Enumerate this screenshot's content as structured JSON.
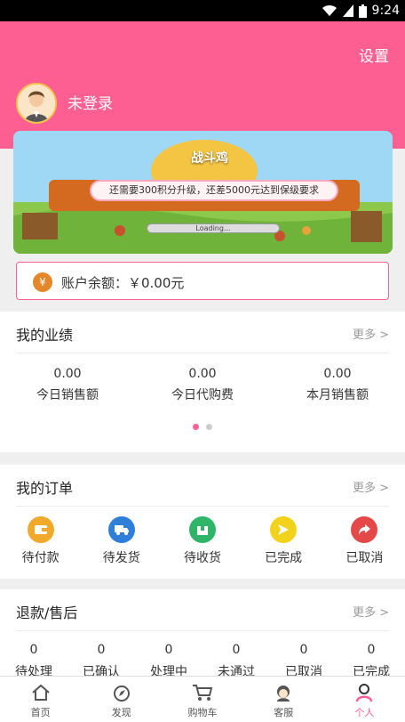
{
  "status_bar": {
    "time": "9:24"
  },
  "header": {
    "settings_label": "设置",
    "login_label": "未登录"
  },
  "banner": {
    "title": "战斗鸡",
    "message": "还需要300积分升级，还差5000元达到保级要求",
    "loading_text": "Loading..."
  },
  "balance": {
    "label": "账户余额：￥0.00元",
    "icon_char": "¥"
  },
  "performance": {
    "title": "我的业绩",
    "more": "更多 >",
    "items": [
      {
        "value": "0.00",
        "label": "今日销售额"
      },
      {
        "value": "0.00",
        "label": "今日代购费"
      },
      {
        "value": "0.00",
        "label": "本月销售额"
      }
    ]
  },
  "orders": {
    "title": "我的订单",
    "more": "更多 >",
    "items": [
      {
        "label": "待付款",
        "icon": "wallet-icon",
        "color": "#f0a92b"
      },
      {
        "label": "待发货",
        "icon": "truck-icon",
        "color": "#2f7fd8"
      },
      {
        "label": "待收货",
        "icon": "package-icon",
        "color": "#2fb567"
      },
      {
        "label": "已完成",
        "icon": "send-icon",
        "color": "#f3d21b"
      },
      {
        "label": "已取消",
        "icon": "share-icon",
        "color": "#e44848"
      }
    ]
  },
  "refunds": {
    "title": "退款/售后",
    "more": "更多 >",
    "items": [
      {
        "value": "0",
        "label": "待处理"
      },
      {
        "value": "0",
        "label": "已确认"
      },
      {
        "value": "0",
        "label": "处理中"
      },
      {
        "value": "0",
        "label": "未通过"
      },
      {
        "value": "0",
        "label": "已取消"
      },
      {
        "value": "0",
        "label": "已完成"
      }
    ]
  },
  "tabbar": {
    "items": [
      {
        "label": "首页",
        "icon": "home-icon"
      },
      {
        "label": "发现",
        "icon": "discover-icon"
      },
      {
        "label": "购物车",
        "icon": "cart-icon"
      },
      {
        "label": "客服",
        "icon": "service-icon"
      },
      {
        "label": "个人",
        "icon": "profile-icon"
      }
    ],
    "active_color": "#fd5f93"
  }
}
